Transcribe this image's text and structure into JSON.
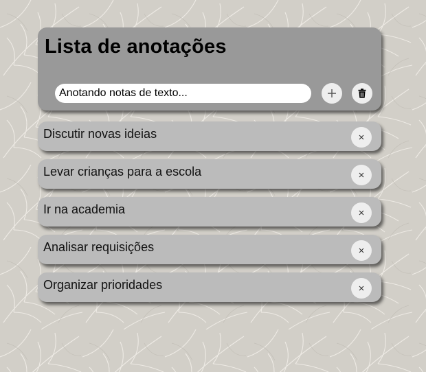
{
  "header": {
    "title": "Lista de anotações",
    "input": {
      "placeholder": "Anotando notas de texto...",
      "value": ""
    },
    "add_button_icon": "plus-icon",
    "clear_button_icon": "trash-icon"
  },
  "notes": [
    {
      "text": "Discutir novas ideias",
      "remove_icon": "close-icon"
    },
    {
      "text": "Levar crianças para a escola",
      "remove_icon": "close-icon"
    },
    {
      "text": "Ir na academia",
      "remove_icon": "close-icon"
    },
    {
      "text": "Analisar requisições",
      "remove_icon": "close-icon"
    },
    {
      "text": "Organizar prioridades",
      "remove_icon": "close-icon"
    }
  ],
  "colors": {
    "background": "#d2cfc8",
    "header_card": "#999999",
    "note_card": "#bbbbbb",
    "button": "#eeeeee"
  }
}
